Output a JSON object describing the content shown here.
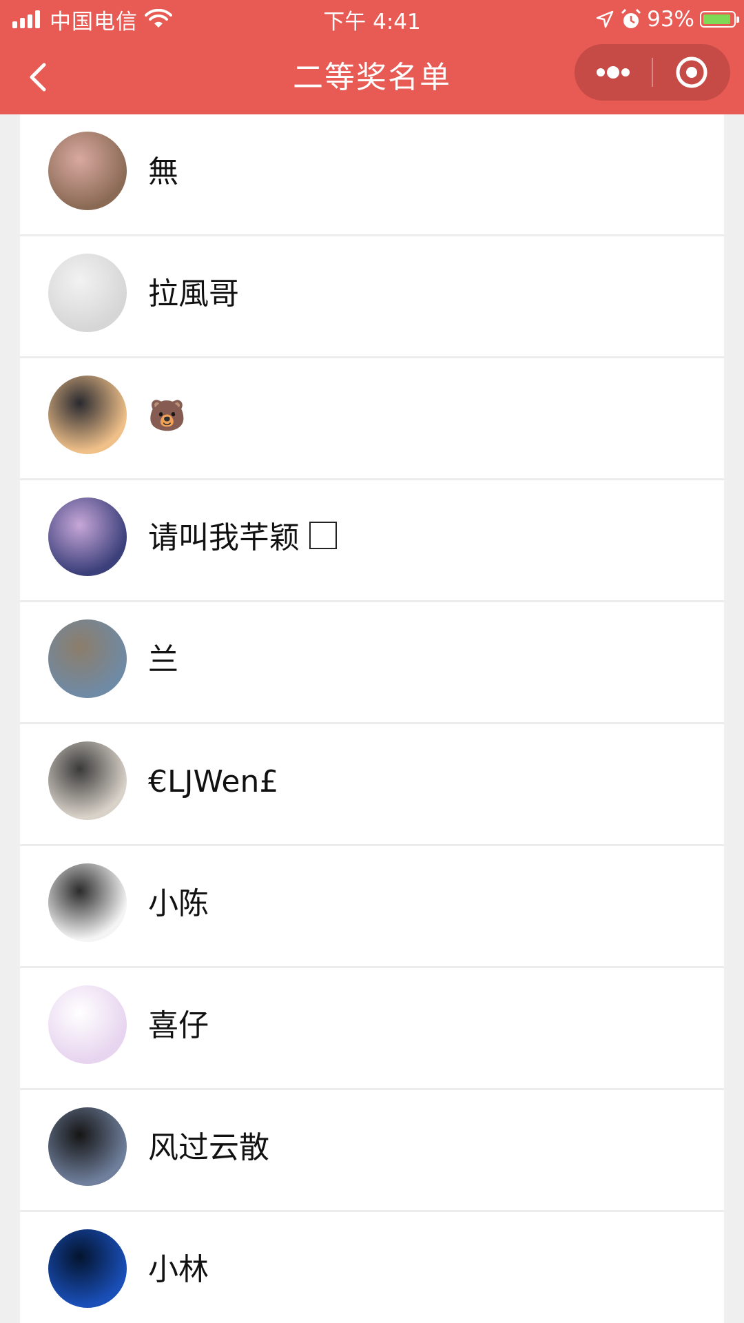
{
  "status_bar": {
    "carrier": "中国电信",
    "time": "下午 4:41",
    "battery_percent": "93%",
    "battery_level": 0.93,
    "signal_bars": 4
  },
  "nav": {
    "title": "二等奖名单"
  },
  "winners": [
    {
      "name": "無",
      "avatar": "pig-figurine-avatar",
      "colors": [
        "#8a6a55",
        "#d9a9a0"
      ]
    },
    {
      "name": "拉風哥",
      "avatar": "bearded-logo-avatar",
      "colors": [
        "#d6d6d6",
        "#f2f2f2"
      ]
    },
    {
      "name": "🐻",
      "avatar": "sunset-person-avatar",
      "colors": [
        "#f0c089",
        "#2a2a30"
      ]
    },
    {
      "name": "请叫我芊颖",
      "has_tofu_box": true,
      "avatar": "anime-girl-avatar",
      "colors": [
        "#3b3f7a",
        "#c7a7d8"
      ]
    },
    {
      "name": "兰",
      "avatar": "rocky-landscape-avatar",
      "colors": [
        "#6f8aa5",
        "#8c7d6a"
      ]
    },
    {
      "name": "€LJWen£",
      "avatar": "boy-glasses-avatar",
      "colors": [
        "#d9d2c9",
        "#3a3a3a"
      ]
    },
    {
      "name": "小陈",
      "avatar": "toddler-avatar",
      "colors": [
        "#f4f4f4",
        "#2b2b2b"
      ]
    },
    {
      "name": "喜仔",
      "avatar": "girl-mask-avatar",
      "colors": [
        "#e7d4ef",
        "#ffffff"
      ]
    },
    {
      "name": "风过云散",
      "avatar": "silhouette-dusk-avatar",
      "colors": [
        "#6f7f9c",
        "#151515"
      ]
    },
    {
      "name": "小林",
      "avatar": "earth-globe-avatar",
      "colors": [
        "#1a4fb8",
        "#03142e"
      ]
    }
  ],
  "theme": {
    "accent": "#e85a54",
    "capsule": "#c64b47",
    "list_bg": "#ffffff",
    "page_bg": "#efefef"
  }
}
